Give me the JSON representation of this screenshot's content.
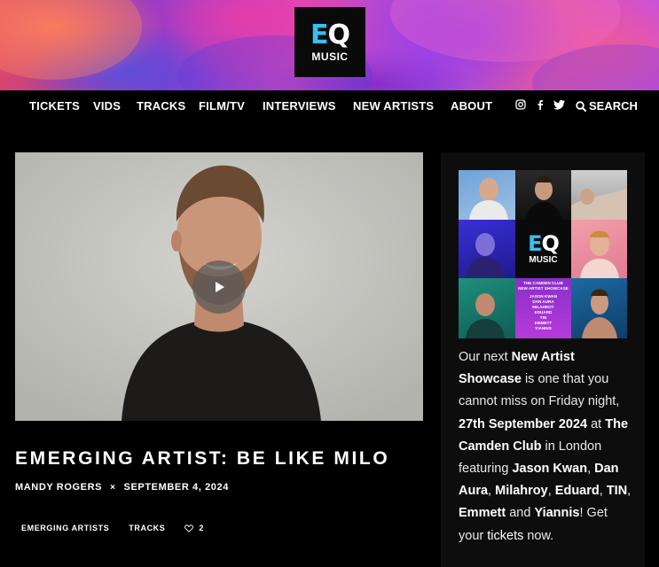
{
  "brand": {
    "logo_line1_e": "E",
    "logo_line1_q": "Q",
    "logo_line2": "MUSIC",
    "accent_color": "#34c0f2"
  },
  "nav": {
    "items": [
      {
        "label": "TICKETS"
      },
      {
        "label": "VIDS"
      },
      {
        "label": "TRACKS"
      },
      {
        "label": "FILM/TV"
      },
      {
        "label": "INTERVIEWS"
      },
      {
        "label": "NEW ARTISTS"
      },
      {
        "label": "ABOUT"
      }
    ],
    "social_icons": [
      "instagram-icon",
      "facebook-icon",
      "twitter-icon"
    ],
    "search_label": "SEARCH"
  },
  "post": {
    "title": "EMERGING ARTIST: BE LIKE MILO",
    "author": "MANDY ROGERS",
    "separator": "×",
    "date": "SEPTEMBER 4, 2024",
    "tags": [
      "EMERGING ARTISTS",
      "TRACKS"
    ],
    "likes": "2"
  },
  "sidebar": {
    "promo_lineup": [
      "THE CAMDEN CLUB",
      "NEW ARTIST SHOWCASE",
      "JASON KWAN",
      "DAN AURA",
      "MILAHROY",
      "EDUARD",
      "TIN",
      "EMMETT",
      "YIANNIS"
    ],
    "text": {
      "p1": "Our next ",
      "b1": "New Artist Showcase",
      "p2": " is one that you cannot miss on Friday night, ",
      "b2": "27th September 2024",
      "p3": " at ",
      "b3": "The Camden Club",
      "p4": " in London featuring ",
      "b4": "Jason Kwan",
      "p5": ", ",
      "b5": "Dan Aura",
      "p6": ", ",
      "b6": "Milahroy",
      "p7": ", ",
      "b7": "Eduard",
      "p8": ", ",
      "b8": "TIN",
      "p9": ", ",
      "b9": "Emmett",
      "p10": " and ",
      "b10": "Yiannis",
      "p11": "! Get your ",
      "link": "tickets",
      "p12": " now."
    }
  }
}
